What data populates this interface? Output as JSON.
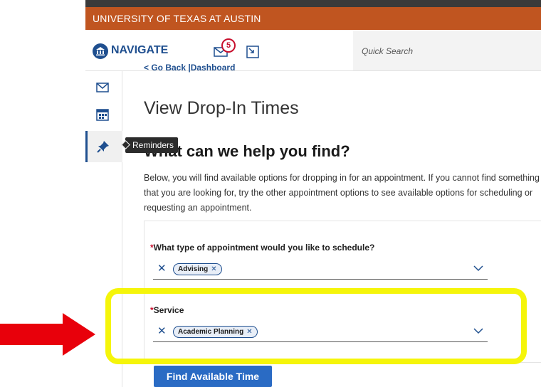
{
  "university_bar": {
    "title": "UNIVERSITY OF TEXAS AT AUSTIN",
    "color": "#c05520"
  },
  "nav": {
    "title": "NAVIGATE",
    "mail_badge_count": "5",
    "search_placeholder": "Quick Search",
    "brand_color": "#1f4f8f"
  },
  "rail": {
    "items": [
      {
        "icon": "envelope-icon"
      },
      {
        "icon": "calendar-icon"
      },
      {
        "icon": "pin-icon",
        "active": true
      }
    ],
    "tooltip": "Reminders"
  },
  "content": {
    "go_back": "< Go Back |Dashboard",
    "page_title": "View Drop-In Times",
    "help_heading": "What can we help you find?",
    "intro": "Below, you will find available options for dropping in for an appointment. If you cannot find something that you are looking for, try the other appointment options to see available options for scheduling or requesting an appointment."
  },
  "form": {
    "appointment_type": {
      "label": "What type of appointment would you like to schedule?",
      "selected": "Advising"
    },
    "service": {
      "label": "Service",
      "selected": "Academic Planning"
    },
    "submit_label": "Find Available Time"
  },
  "annotations": {
    "highlight_color": "#f5f50a",
    "arrow_color": "#e8000b"
  }
}
